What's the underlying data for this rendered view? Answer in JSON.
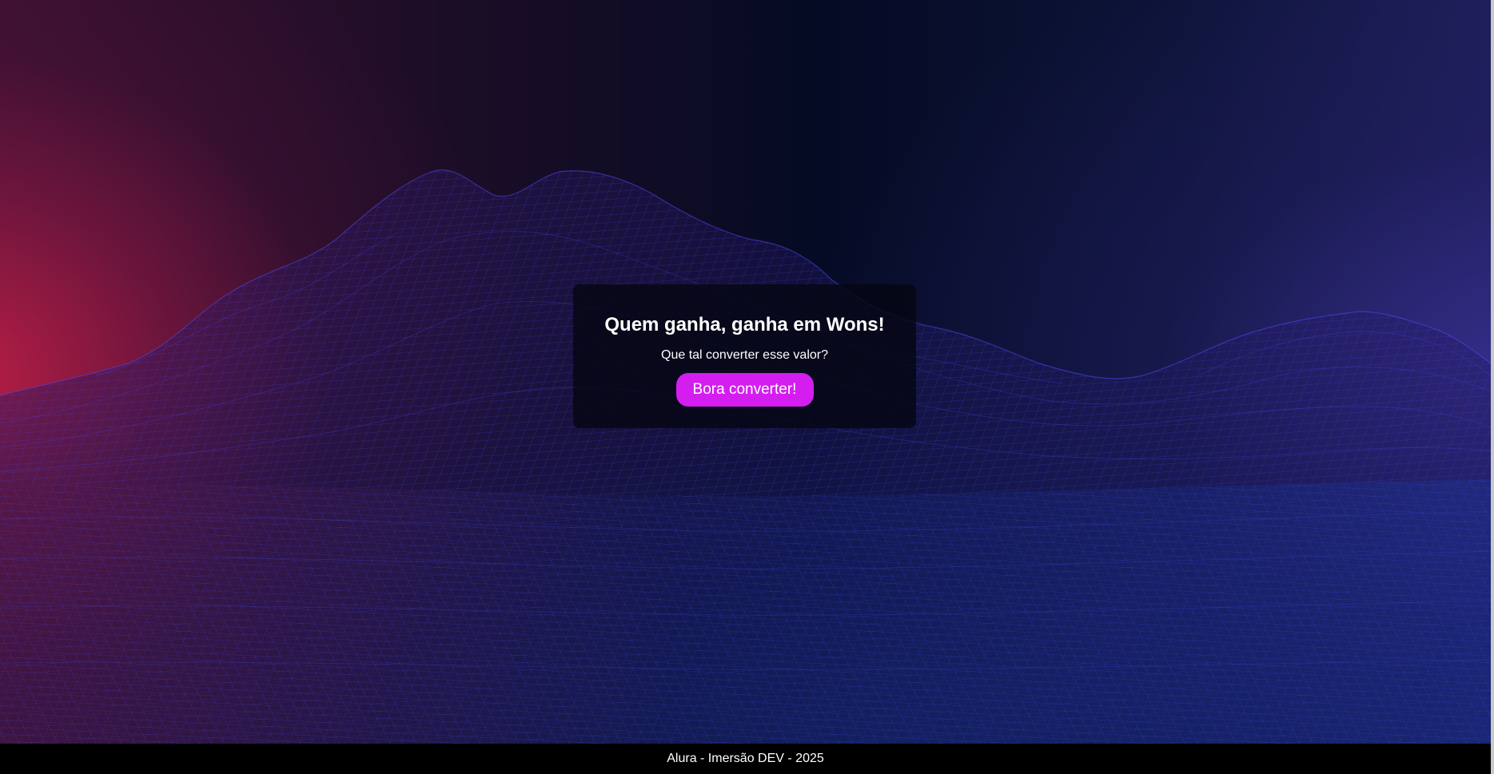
{
  "hero": {
    "title": "Quem ganha, ganha em Wons!",
    "subtitle": "Que tal converter esse valor?",
    "button_label": "Bora converter!"
  },
  "footer": {
    "text": "Alura - Imersão DEV - 2025"
  },
  "colors": {
    "accent_button": "#d41ef0",
    "footer_bg": "#000000",
    "wireframe": "#3b3cdc",
    "glow_left": "#be1e46"
  }
}
